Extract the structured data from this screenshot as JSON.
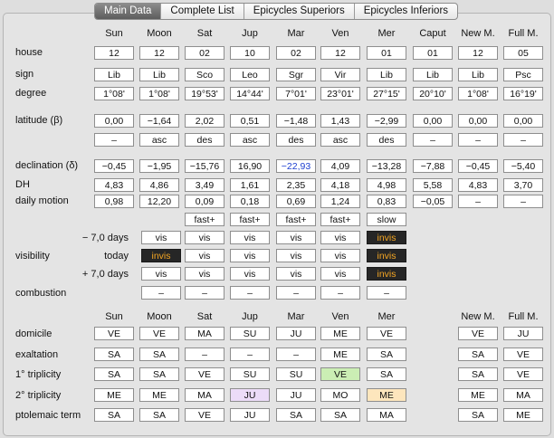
{
  "tabs": [
    "Main Data",
    "Complete List",
    "Epicycles Superiors",
    "Epicycles Inferiors"
  ],
  "active_tab": 0,
  "columns": [
    "Sun",
    "Moon",
    "Sat",
    "Jup",
    "Mar",
    "Ven",
    "Mer",
    "Caput",
    "New M.",
    "Full M."
  ],
  "rows": [
    {
      "label": "house",
      "cells": [
        "12",
        "12",
        "02",
        "10",
        "02",
        "12",
        "01",
        "01",
        "12",
        "05"
      ]
    },
    {
      "label": "sign",
      "cells": [
        "Lib",
        "Lib",
        "Sco",
        "Leo",
        "Sgr",
        "Vir",
        "Lib",
        "Lib",
        "Lib",
        "Psc"
      ]
    },
    {
      "label": "degree",
      "cells": [
        "1°08'",
        "1°08'",
        "19°53'",
        "14°44'",
        "7°01'",
        "23°01'",
        "27°15'",
        "20°10'",
        "1°08'",
        "16°19'"
      ]
    },
    {
      "label": "latitude (β)",
      "cells": [
        "0,00",
        "−1,64",
        "2,02",
        "0,51",
        "−1,48",
        "1,43",
        "−2,99",
        "0,00",
        "0,00",
        "0,00"
      ]
    },
    {
      "label": "",
      "cells": [
        "–",
        "asc",
        "des",
        "asc",
        "des",
        "asc",
        "des",
        "–",
        "–",
        "–"
      ]
    },
    {
      "label": "declination (δ)",
      "cells": [
        "−0,45",
        "−1,95",
        "−15,76",
        "16,90",
        "−22,93",
        "4,09",
        "−13,28",
        "−7,88",
        "−0,45",
        "−5,40"
      ]
    },
    {
      "label": "DH",
      "cells": [
        "4,83",
        "4,86",
        "3,49",
        "1,61",
        "2,35",
        "4,18",
        "4,98",
        "5,58",
        "4,83",
        "3,70"
      ]
    },
    {
      "label": "daily motion",
      "cells": [
        "0,98",
        "12,20",
        "0,09",
        "0,18",
        "0,69",
        "1,24",
        "0,83",
        "−0,05",
        "–",
        "–"
      ]
    },
    {
      "label": "",
      "cells": [
        "",
        "",
        "fast+",
        "fast+",
        "fast+",
        "fast+",
        "slow",
        "",
        "",
        ""
      ]
    }
  ],
  "visibility": {
    "label": "visibility",
    "rows": [
      {
        "sublabel": "− 7,0 days",
        "cells": [
          "vis",
          "vis",
          "vis",
          "vis",
          "vis",
          "invis"
        ]
      },
      {
        "sublabel": "today",
        "cells": [
          "invis",
          "vis",
          "vis",
          "vis",
          "vis",
          "invis"
        ]
      },
      {
        "sublabel": "+ 7,0 days",
        "cells": [
          "vis",
          "vis",
          "vis",
          "vis",
          "vis",
          "invis"
        ]
      }
    ],
    "dark_value": "invis"
  },
  "combustion": {
    "label": "combustion",
    "cells": [
      "–",
      "–",
      "–",
      "–",
      "–",
      "–"
    ]
  },
  "dignity_columns": [
    "Sun",
    "Moon",
    "Sat",
    "Jup",
    "Mar",
    "Ven",
    "Mer",
    "",
    "New M.",
    "Full M."
  ],
  "dignities": [
    {
      "label": "domicile",
      "cells": [
        "VE",
        "VE",
        "MA",
        "SU",
        "JU",
        "ME",
        "VE",
        "",
        "VE",
        "JU"
      ]
    },
    {
      "label": "exaltation",
      "cells": [
        "SA",
        "SA",
        "–",
        "–",
        "–",
        "ME",
        "SA",
        "",
        "SA",
        "VE"
      ]
    },
    {
      "label": "1° triplicity",
      "cells": [
        "SA",
        "SA",
        "VE",
        "SU",
        "SU",
        "VE",
        "SA",
        "",
        "SA",
        "VE"
      ]
    },
    {
      "label": "2° triplicity",
      "cells": [
        "ME",
        "ME",
        "MA",
        "JU",
        "JU",
        "MO",
        "ME",
        "",
        "ME",
        "MA"
      ]
    },
    {
      "label": "ptolemaic term",
      "cells": [
        "SA",
        "SA",
        "VE",
        "JU",
        "SA",
        "SA",
        "MA",
        "",
        "SA",
        "ME"
      ]
    }
  ],
  "highlights": {
    "green": "#cbeeb4",
    "violet": "#ecdcf8",
    "orange": "#fde6bd",
    "blue_text": "#1d3fd0",
    "invis_bg": "#262626",
    "invis_text": "#f5a623"
  }
}
